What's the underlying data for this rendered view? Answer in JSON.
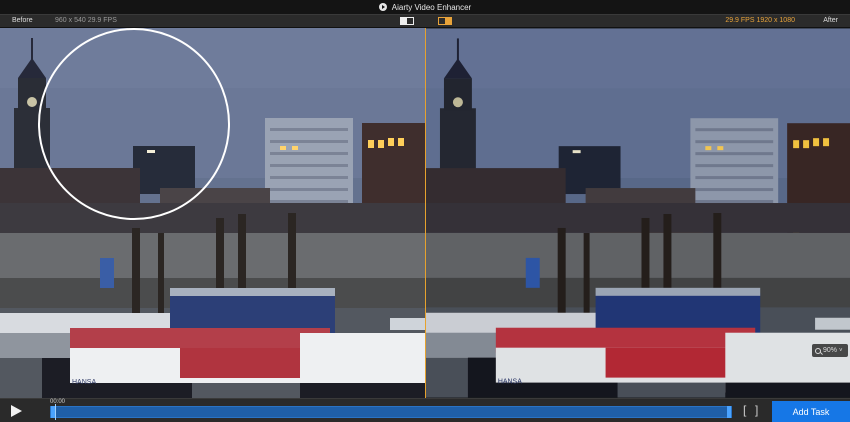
{
  "app": {
    "title": "Aiarty Video Enhancer",
    "logo_icon": "play-logo-icon"
  },
  "infobar": {
    "before_label": "Before",
    "before_info": "960 x 540  29.9 FPS",
    "after_label": "After",
    "after_info": "29.9 FPS  1920 x 1080",
    "accent_color": "#e8a33a"
  },
  "preview": {
    "overlay_color": "#ffffff",
    "divider_color": "#e6a22e",
    "zoom": {
      "value": "90%",
      "icon": "magnifier-icon",
      "caret": "˅"
    }
  },
  "scene": {
    "boat_names": [
      "HANSA",
      "HANSA"
    ]
  },
  "controls": {
    "play_icon": "play-icon",
    "time": "00:00",
    "in_bracket": "[",
    "out_bracket": "]",
    "add_task_label": "Add Task",
    "timeline_color": "#1f5fa8",
    "button_color": "#1677e6"
  }
}
